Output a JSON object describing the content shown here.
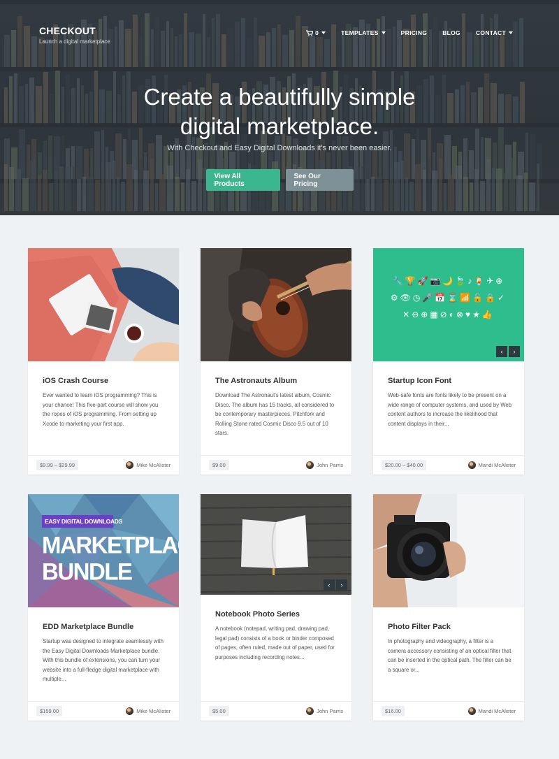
{
  "brand": {
    "title": "CHECKOUT",
    "subtitle": "Launch a digital marketplace"
  },
  "nav": {
    "cart_icon": "cart-icon",
    "cart_count": "0",
    "items": [
      "TEMPLATES",
      "PRICING",
      "BLOG",
      "CONTACT"
    ]
  },
  "hero": {
    "title_line1": "Create a beautifully simple",
    "title_line2": "digital marketplace.",
    "subtitle": "With Checkout and Easy Digital Downloads it's never been easier.",
    "primary_button": "View All Products",
    "secondary_button": "See Our Pricing"
  },
  "products": [
    {
      "title": "iOS Crash Course",
      "description": "Ever wanted to learn iOS programming? This is your chance! This five-part course will show you the ropes of iOS programming. From setting up Xcode to marketing your first app.",
      "price": "$9.99 – $29.99",
      "author": "Mike McAlister"
    },
    {
      "title": "The Astronauts Album",
      "description": "Download The Astronaut's latest album, Cosmic Disco. The album has 15 tracks, all considered to be contemporary masterpieces. Pitchfork and Rolling Stone rated Cosmic Disco 9.5 out of 10 stars.",
      "price": "$9.00",
      "author": "John Parris"
    },
    {
      "title": "Startup Icon Font",
      "description": "Web-safe fonts are fonts likely to be present on a wide range of computer systems, and used by Web content authors to increase the likelihood that content displays in their...",
      "price": "$20.00 – $40.00",
      "author": "Mandi McAlister"
    },
    {
      "title": "EDD Marketplace Bundle",
      "description": "Startup was designed to integrate seamlessly with the Easy Digital Downloads Marketplace bundle. With this bundle of extensions, you can turn your website into a full-fledge digital marketplace with multiple...",
      "price": "$159.00",
      "author": "Mike McAlister",
      "image_tag": "EASY DIGITAL DOWNLOADS",
      "image_line1": "MARKETPLACE",
      "image_line2": "BUNDLE"
    },
    {
      "title": "Notebook Photo Series",
      "description": "A notebook (notepad, writing pad, drawing pad, legal pad) consists of a book or binder composed of pages, often ruled, made out of paper, used for purposes including recording notes...",
      "price": "$5.00",
      "author": "John Parris"
    },
    {
      "title": "Photo Filter Pack",
      "description": "In photography and videography, a filter is a camera accessory consisting of an optical filter that can be inserted in the optical path. The filter can be a square or...",
      "price": "$16.00",
      "author": "Mandi McAlister"
    }
  ],
  "slider": {
    "prev": "‹",
    "next": "›"
  },
  "icon_font_rows": [
    "🔧🏆🚀📷🌙🍃♪🍹✈⊕",
    "⚙👁◷🎤📅⌛📶🔓🔒✓",
    "✕⊖⊕▦⊘◐⊗♥★👍"
  ],
  "colors": {
    "accent": "#3cb68e",
    "secondary": "#7d9196",
    "icon_bg": "#2ebd8c"
  }
}
